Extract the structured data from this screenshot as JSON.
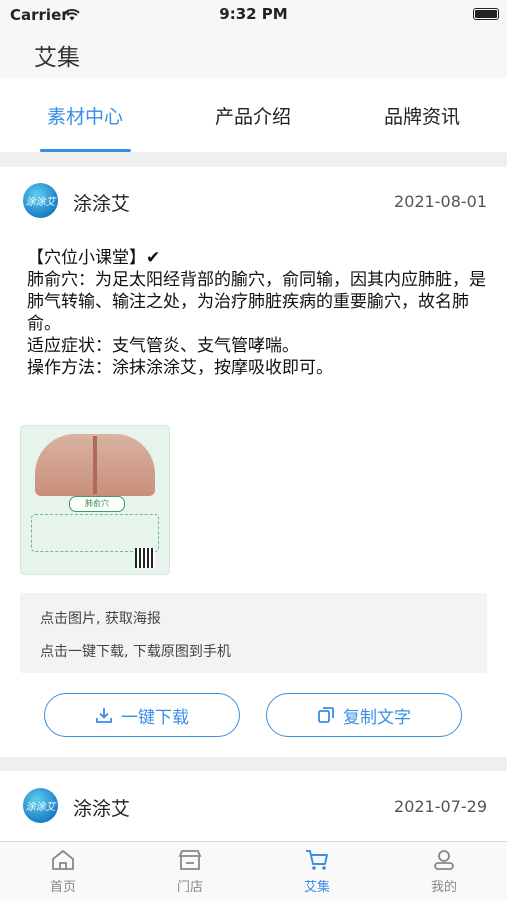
{
  "status_bar": {
    "carrier": "Carrier",
    "time": "9:32 PM"
  },
  "nav": {
    "title": "艾集"
  },
  "tabs": [
    {
      "label": "素材中心",
      "active": true
    },
    {
      "label": "产品介绍",
      "active": false
    },
    {
      "label": "品牌资讯",
      "active": false
    }
  ],
  "posts": [
    {
      "avatar_text": "涂涂艾",
      "author": "涂涂艾",
      "date": "2021-08-01",
      "content": [
        "【穴位小课堂】✔",
        "肺俞穴：为足太阳经背部的腧穴，俞同输，因其内应肺脏，是肺气转输、输注之处，为治疗肺脏疾病的重要腧穴，故名肺俞。",
        "适应症状：支气管炎、支气管哮喘。",
        "操作方法：涂抹涂涂艾，按摩吸收即可。"
      ],
      "poster_label": "肺俞穴",
      "hints": [
        "点击图片, 获取海报",
        "点击一键下载, 下载原图到手机"
      ],
      "download_label": "一键下载",
      "copy_label": "复制文字"
    },
    {
      "avatar_text": "涂涂艾",
      "author": "涂涂艾",
      "date": "2021-07-29"
    }
  ],
  "tabbar": [
    {
      "label": "首页",
      "icon": "home-icon",
      "active": false
    },
    {
      "label": "门店",
      "icon": "store-icon",
      "active": false
    },
    {
      "label": "艾集",
      "icon": "cart-icon",
      "active": true
    },
    {
      "label": "我的",
      "icon": "user-icon",
      "active": false
    }
  ],
  "colors": {
    "accent": "#3a8ee6",
    "background": "#efefef"
  }
}
